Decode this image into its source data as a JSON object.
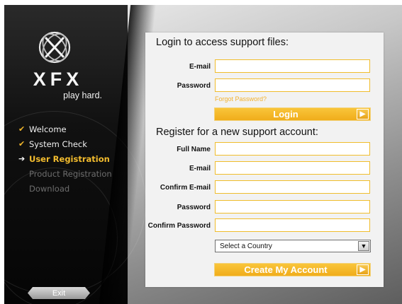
{
  "brand": {
    "logo_text": "XFX",
    "tagline": "play hard."
  },
  "steps": [
    {
      "label": "Welcome",
      "state": "done",
      "icon": "check-icon"
    },
    {
      "label": "System Check",
      "state": "done",
      "icon": "check-icon"
    },
    {
      "label": "User Registration",
      "state": "current",
      "icon": "arrow-right-icon"
    },
    {
      "label": "Product Registration",
      "state": "pending"
    },
    {
      "label": "Download",
      "state": "pending"
    }
  ],
  "exit_label": "Exit",
  "login": {
    "title": "Login to access support files:",
    "email_label": "E-mail",
    "email_value": "",
    "password_label": "Password",
    "password_value": "",
    "forgot_link": "Forgot Password?",
    "button_label": "Login"
  },
  "register": {
    "title": "Register for a new support account:",
    "full_name_label": "Full Name",
    "email_label": "E-mail",
    "confirm_email_label": "Confirm E-mail",
    "password_label": "Password",
    "confirm_password_label": "Confirm Password",
    "country_value": "Select a Country",
    "button_label": "Create My Account"
  },
  "colors": {
    "accent": "#f2b22a",
    "sidebar_bg": "#0d0d0d",
    "panel_bg": "#f2f2f2"
  }
}
